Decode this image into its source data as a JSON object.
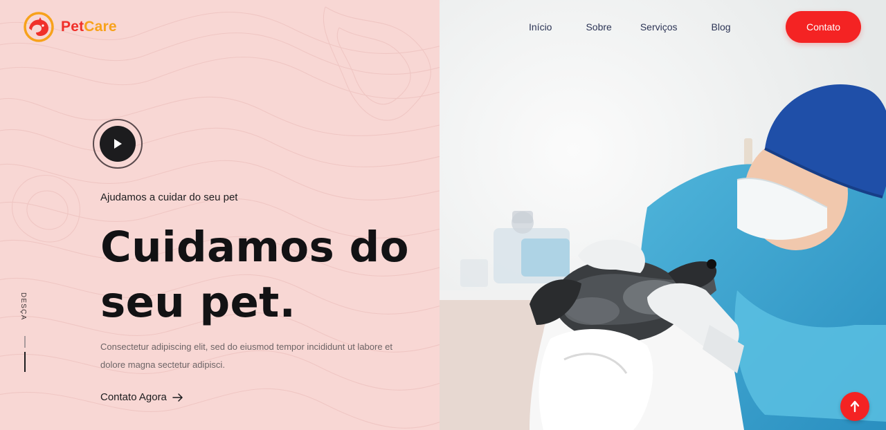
{
  "brand": {
    "name_part1": "Pet",
    "name_part2": "Care",
    "colors": {
      "red": "#f0302a",
      "orange": "#f7a21b"
    }
  },
  "nav": {
    "items": [
      "Início",
      "Sobre",
      "Serviços",
      "Blog"
    ],
    "contact_label": "Contato"
  },
  "hero": {
    "subtitle": "Ajudamos a cuidar do seu pet",
    "headline": "Cuidamos do seu pet.",
    "description": "Consectetur adipiscing elit, sed do eiusmod tempor incididunt ut labore et dolore magna sectetur adipisci.",
    "cta_label": "Contato Agora",
    "play_icon": "play-icon",
    "background_color": "#f8d7d4"
  },
  "scroll": {
    "label": "DESÇA"
  },
  "back_to_top": {
    "icon": "arrow-up-icon",
    "color": "#f42323"
  }
}
